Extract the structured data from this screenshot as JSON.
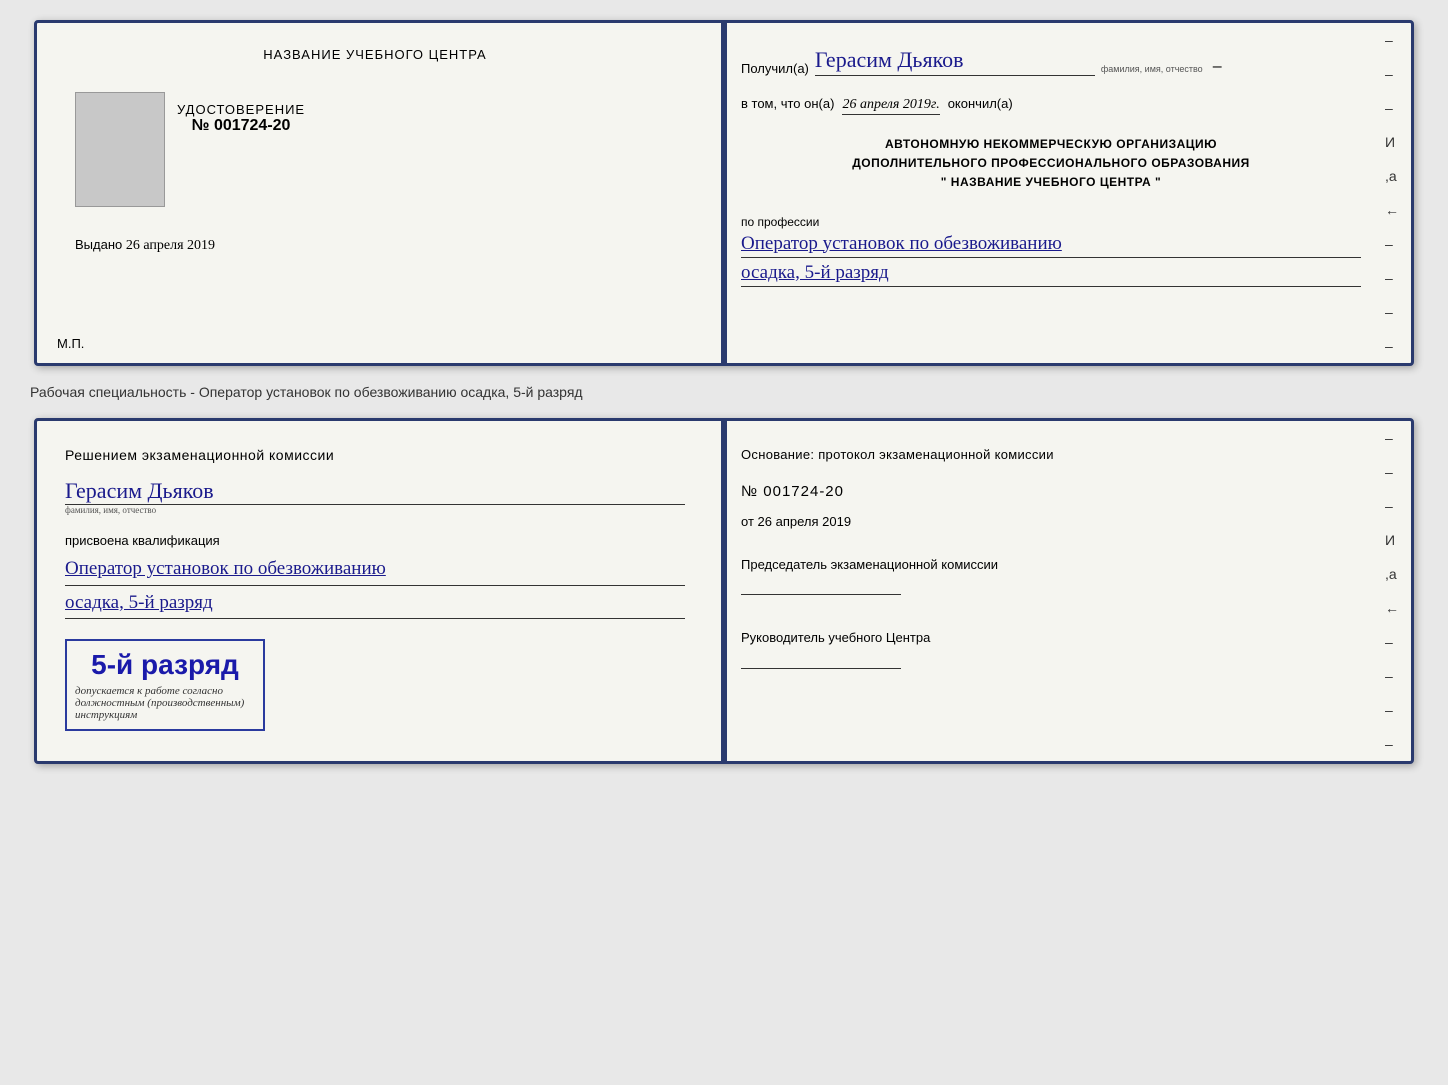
{
  "top_card": {
    "left": {
      "center_title": "НАЗВАНИЕ УЧЕБНОГО ЦЕНТРА",
      "cert_label": "УДОСТОВЕРЕНИЕ",
      "cert_number": "№ 001724-20",
      "issued_label": "Выдано",
      "issued_date": "26 апреля 2019",
      "mp_label": "М.П."
    },
    "right": {
      "received_label": "Получил(а)",
      "recipient_name": "Герасим Дьяков",
      "fio_sub": "фамилия, имя, отчество",
      "dash": "–",
      "date_intro": "в том, что он(а)",
      "date_value": "26 апреля 2019г.",
      "finished_label": "окончил(а)",
      "org_line1": "АВТОНОМНУЮ НЕКОММЕРЧЕСКУЮ ОРГАНИЗАЦИЮ",
      "org_line2": "ДОПОЛНИТЕЛЬНОГО ПРОФЕССИОНАЛЬНОГО ОБРАЗОВАНИЯ",
      "org_line3": "\" НАЗВАНИЕ УЧЕБНОГО ЦЕНТРА \"",
      "profession_label": "по профессии",
      "profession_line1": "Оператор установок по обезвоживанию",
      "profession_line2": "осадка, 5-й разряд"
    }
  },
  "middle_text": "Рабочая специальность - Оператор установок по обезвоживанию осадка, 5-й разряд",
  "bottom_card": {
    "left": {
      "commission_title": "Решением экзаменационной комиссии",
      "person_name": "Герасим Дьяков",
      "fio_sub": "фамилия, имя, отчество",
      "qualification_label": "присвоена квалификация",
      "qualification_line1": "Оператор установок по обезвоживанию",
      "qualification_line2": "осадка, 5-й разряд",
      "stamp_rank": "5-й разряд",
      "stamp_permission": "допускается к работе согласно должностным (производственным) инструкциям"
    },
    "right": {
      "protocol_title": "Основание: протокол экзаменационной комиссии",
      "protocol_number": "№ 001724-20",
      "protocol_date_label": "от",
      "protocol_date": "26 апреля 2019",
      "chairman_title": "Председатель экзаменационной комиссии",
      "director_title": "Руководитель учебного Центра"
    }
  },
  "dashes": [
    "-",
    "-",
    "-",
    "И",
    ",а",
    "←",
    "-",
    "-",
    "-",
    "-"
  ]
}
